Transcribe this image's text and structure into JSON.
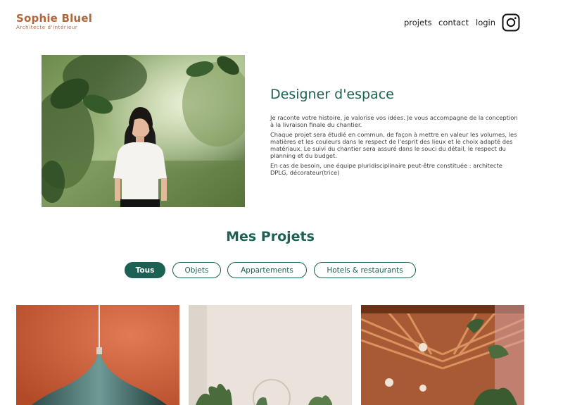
{
  "header": {
    "logo_name": "Sophie Bluel",
    "logo_subtitle": "Architecte d'intérieur",
    "nav": {
      "projets": "projets",
      "contact": "contact",
      "login": "login"
    },
    "social_icon": "instagram-icon"
  },
  "introduction": {
    "title": "Designer d'espace",
    "paragraphs": [
      "Je raconte votre histoire, je valorise vos idées. Je vous accompagne de la conception à la livraison finale du chantier.",
      "Chaque projet sera étudié en commun, de façon à mettre en valeur les volumes, les matières et les couleurs dans le respect de l'esprit des lieux et le choix adapté des matériaux. Le suivi du chantier sera assuré dans le souci du détail, le respect du planning et du budget.",
      "En cas de besoin, une équipe pluridisciplinaire peut-être constituée : architecte DPLG, décorateur(trice)"
    ]
  },
  "projects": {
    "title": "Mes Projets",
    "filters": [
      "Tous",
      "Objets",
      "Appartements",
      "Hotels & restaurants"
    ],
    "active_filter": "Tous"
  },
  "colors": {
    "brand": "#b1663c",
    "accent": "#1d6154"
  }
}
